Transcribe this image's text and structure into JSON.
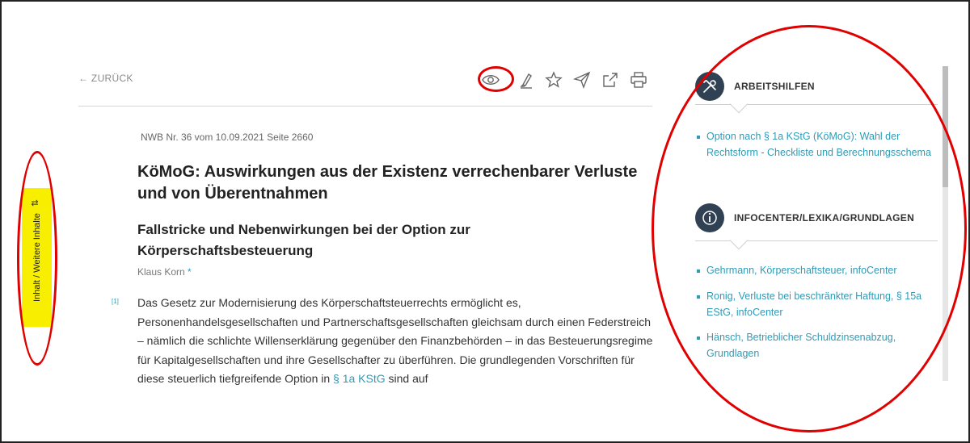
{
  "nav": {
    "back_label": "← ZURÜCK"
  },
  "toolbar": {
    "icons": [
      "eye-icon",
      "highlighter-icon",
      "star-icon",
      "send-icon",
      "share-icon",
      "print-icon"
    ]
  },
  "side_tab": {
    "label": "Inhalt / Weitere Inhalte",
    "swap_glyph": "⇅"
  },
  "article": {
    "meta": "NWB Nr. 36 vom 10.09.2021 Seite 2660",
    "title": "KöMoG: Auswirkungen aus der Existenz verrechenbarer Verluste und von Überentnahmen",
    "subtitle": "Fallstricke und Nebenwirkungen bei der Option zur Körperschaftsbesteuerung",
    "author": "Klaus Korn",
    "author_marker": "*",
    "para_number": "[1]",
    "body_before_link": "Das Gesetz zur Modernisierung des Körperschaftsteuerrechts ermöglicht es, Personenhandelsgesellschaften und Partnerschaftsgesellschaften gleichsam durch einen Federstreich – nämlich die schlichte Willenserklärung gegenüber den Finanzbehörden – in das Besteuerungsregime für Kapitalgesellschaften und ihre Gesellschafter zu überführen. Die grundlegenden Vorschriften für diese steuerlich tiefgreifende Option in ",
    "body_link": "§ 1a KStG",
    "body_after_link": " sind auf"
  },
  "panel": {
    "arbeitshilfen": {
      "title": "ARBEITSHILFEN",
      "icon": "tools-icon",
      "links": [
        "Option nach § 1a KStG (KöMoG): Wahl der Rechtsform - Checkliste und Berechnungsschema"
      ]
    },
    "infocenter": {
      "title": "INFOCENTER/LEXIKA/GRUNDLAGEN",
      "icon": "info-icon",
      "links": [
        "Gehrmann, Körperschaftsteuer, infoCenter",
        "Ronig, Verluste bei beschränkter Haftung, § 15a EStG, infoCenter",
        "Hänsch, Betrieblicher Schuldzinsenabzug, Grundlagen"
      ]
    }
  },
  "colors": {
    "link": "#2f9bb7",
    "highlight": "#f7ee00",
    "annotation": "#e00000",
    "icon_circle": "#2f4152"
  }
}
